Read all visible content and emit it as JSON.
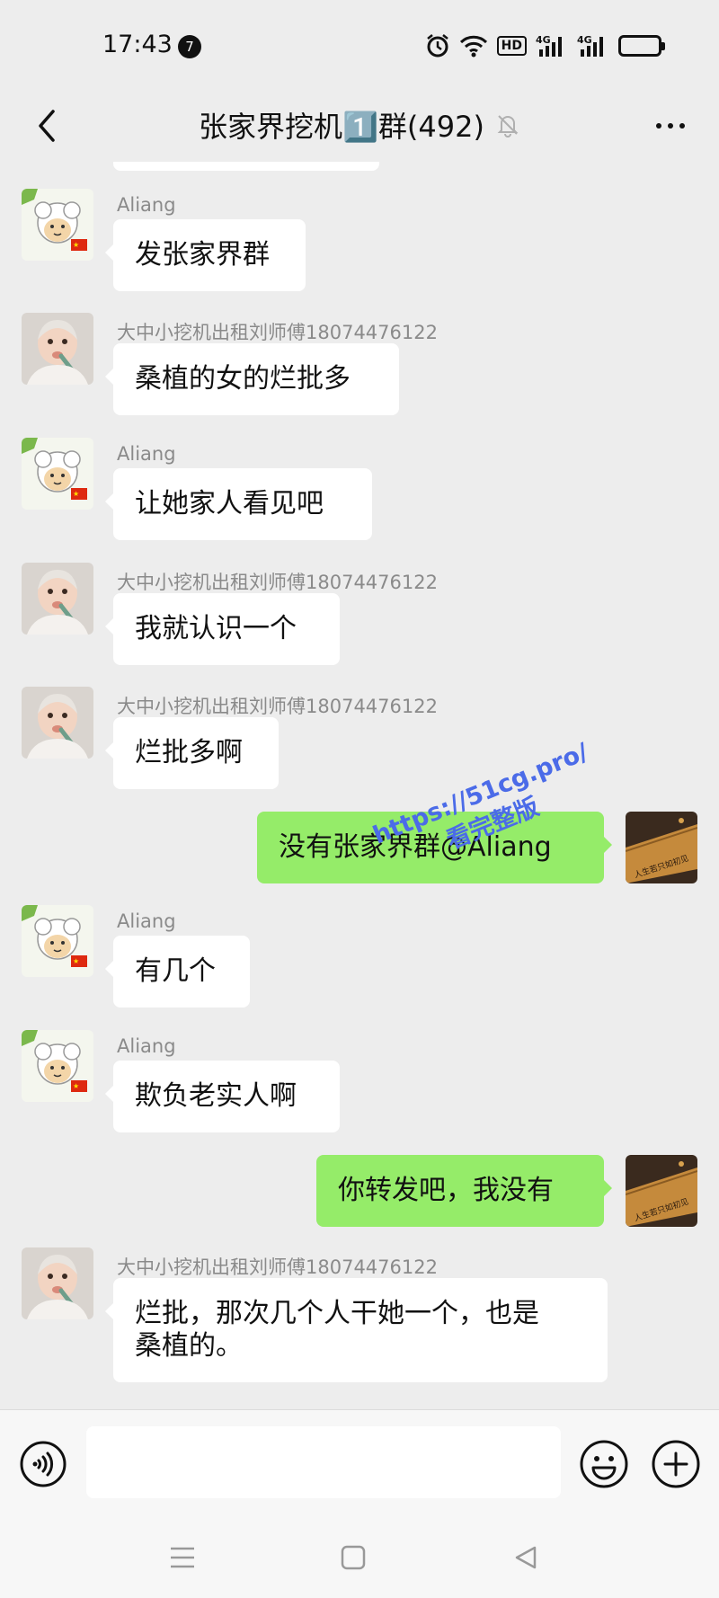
{
  "status_bar": {
    "time": "17:43",
    "notification_count": "7",
    "hd_label": "HD",
    "signal_labels": [
      "4G",
      "4G"
    ]
  },
  "header": {
    "title": "张家界挖机1️⃣群(492)",
    "back_icon": "chevron-left-icon",
    "mute_icon": "bell-muted-icon",
    "more_icon": "more-dots-icon"
  },
  "colors": {
    "background": "#ededed",
    "bubble_self": "#95ec69",
    "bubble_other": "#ffffff",
    "sender_name": "#8a8a8a",
    "watermark": "#4b6be8"
  },
  "messages": [
    {
      "side": "left",
      "sender": "Aliang",
      "avatar": "sheep-avatar",
      "text": "发张家界群"
    },
    {
      "side": "left",
      "sender": "大中小挖机出租刘师傅18074476122",
      "avatar": "baby-avatar",
      "text": "桑植的女的烂批多"
    },
    {
      "side": "left",
      "sender": "Aliang",
      "avatar": "sheep-avatar",
      "text": "让她家人看见吧"
    },
    {
      "side": "left",
      "sender": "大中小挖机出租刘师傅18074476122",
      "avatar": "baby-avatar",
      "text": "我就认识一个"
    },
    {
      "side": "left",
      "sender": "大中小挖机出租刘师傅18074476122",
      "avatar": "baby-avatar",
      "text": "烂批多啊"
    },
    {
      "side": "right",
      "sender": "",
      "avatar": "self-avatar",
      "text": "没有张家界群@Aliang"
    },
    {
      "side": "left",
      "sender": "Aliang",
      "avatar": "sheep-avatar",
      "text": "有几个"
    },
    {
      "side": "left",
      "sender": "Aliang",
      "avatar": "sheep-avatar",
      "text": "欺负老实人啊"
    },
    {
      "side": "right",
      "sender": "",
      "avatar": "self-avatar",
      "text": "你转发吧，我没有"
    },
    {
      "side": "left",
      "sender": "大中小挖机出租刘师傅18074476122",
      "avatar": "baby-avatar",
      "text": "烂批，那次几个人干她一个，也是\n桑植的。"
    }
  ],
  "watermark": {
    "line1": "https://51cg.pro/",
    "line2": "看完整版"
  },
  "input_bar": {
    "voice_icon": "voice-icon",
    "emoji_icon": "emoji-icon",
    "plus_icon": "plus-icon",
    "placeholder": ""
  },
  "nav_bar": {
    "icons": [
      "menu-icon",
      "home-square-icon",
      "back-triangle-icon"
    ]
  }
}
